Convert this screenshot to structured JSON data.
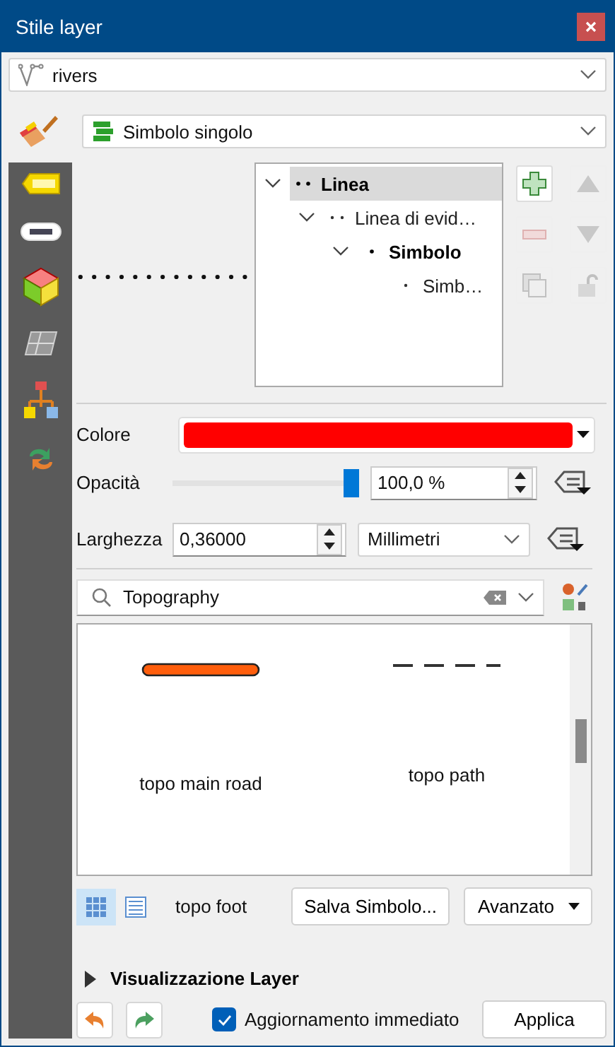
{
  "window": {
    "title": "Stile layer"
  },
  "layer_combo": {
    "value": "rivers"
  },
  "renderer_combo": {
    "value": "Simbolo singolo"
  },
  "symbol_tree": [
    {
      "label": "Linea",
      "kind": "symbol",
      "selected": true,
      "expanded": true,
      "children": [
        {
          "label": "Linea di evid…",
          "kind": "layer",
          "selected": false,
          "expanded": true,
          "children": [
            {
              "label": "Simbolo",
              "kind": "symbol",
              "selected": false,
              "expanded": true,
              "children": [
                {
                  "label": "Simb…",
                  "kind": "layer",
                  "selected": false
                }
              ]
            }
          ]
        }
      ]
    }
  ],
  "tree_buttons": [
    {
      "kind": "add",
      "disabled": false
    },
    {
      "kind": "up",
      "disabled": true
    },
    {
      "kind": "remove",
      "disabled": true
    },
    {
      "kind": "down",
      "disabled": true
    },
    {
      "kind": "duplicate",
      "disabled": true
    },
    {
      "kind": "lock",
      "disabled": true
    }
  ],
  "color": {
    "label": "Colore",
    "color": "#ff0000"
  },
  "opacity": {
    "label": "Opacità",
    "level": 1.0,
    "value": "100,0 %"
  },
  "width": {
    "label": "Larghezza",
    "value": "0,36000",
    "unit": "Millimetri"
  },
  "search": {
    "value": "Topography"
  },
  "symbols": [
    {
      "name": "topo main road",
      "kind": "road"
    },
    {
      "name": "topo path",
      "kind": "path"
    }
  ],
  "view_modes": [
    {
      "kind": "icons",
      "selected": true
    },
    {
      "kind": "list",
      "selected": false
    }
  ],
  "current_symbol": "topo foot",
  "save_button": "Salva Simbolo...",
  "advanced_button": "Avanzato",
  "section": {
    "label": "Visualizzazione Layer",
    "expanded": false
  },
  "live_update": {
    "label": "Aggiornamento immediato",
    "checked": true
  },
  "apply_button": "Applica"
}
